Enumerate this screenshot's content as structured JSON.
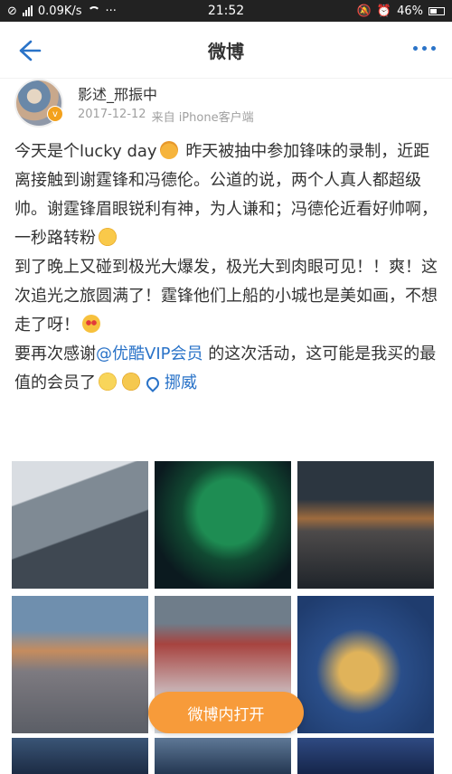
{
  "status_bar": {
    "network_speed": "0.09K/s",
    "time": "21:52",
    "battery": "46%"
  },
  "nav": {
    "title": "微博"
  },
  "author": {
    "name": "影述_邢振中",
    "date": "2017-12-12",
    "source": "来自 iPhone客户端"
  },
  "post": {
    "seg1": "今天是个lucky day",
    "seg2": "昨天被抽中参加锋味的录制，近距离接触到谢霆锋和冯德伦。公道的说，两个人真人都超级帅。谢霆锋眉眼锐利有神，为人谦和；冯德伦近看好帅啊，一秒路转粉",
    "seg3": "到了晚上又碰到极光大爆发，极光大到肉眼可见！！爽！这次追光之旅圆满了！霆锋他们上船的小城也是美如画，不想走了呀！",
    "seg4": "要再次感谢",
    "mention": "@优酷VIP会员",
    "seg5": " 的这次活动，这可能是我买的最值的会员了",
    "location": "挪威"
  },
  "open_button": {
    "label": "微博内打开"
  },
  "colors": {
    "link": "#2a73c8",
    "button": "#f79b3a"
  }
}
